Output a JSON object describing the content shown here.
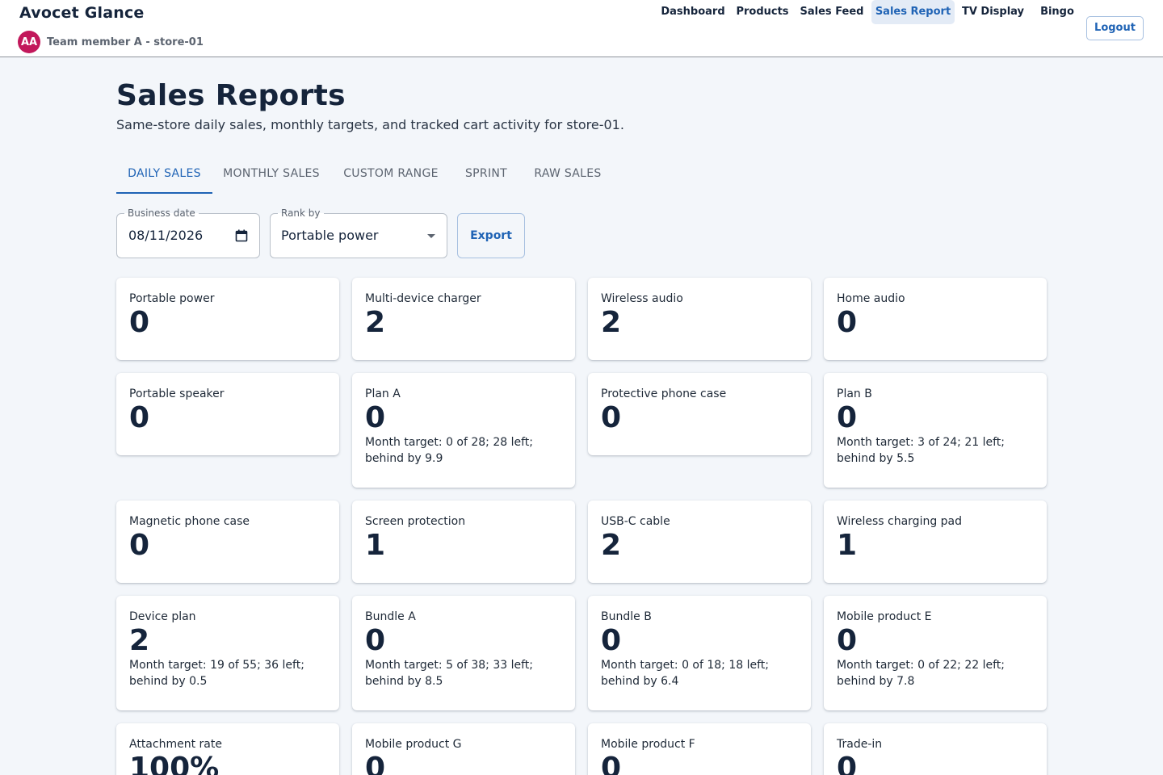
{
  "app": {
    "title": "Avocet Glance",
    "user_initials": "AA",
    "user_label": "Team member A - store-01"
  },
  "nav": {
    "items": [
      {
        "label": "Dashboard",
        "active": false
      },
      {
        "label": "Products",
        "active": false
      },
      {
        "label": "Sales Feed",
        "active": false
      },
      {
        "label": "Sales Report",
        "active": true
      },
      {
        "label": "TV Display",
        "active": false
      },
      {
        "label": "Bingo",
        "active": false
      }
    ],
    "logout_label": "Logout"
  },
  "page": {
    "title": "Sales Reports",
    "subtitle": "Same-store daily sales, monthly targets, and tracked cart activity for store-01."
  },
  "tabs": [
    {
      "label": "DAILY SALES",
      "active": true
    },
    {
      "label": "MONTHLY SALES",
      "active": false
    },
    {
      "label": "CUSTOM RANGE",
      "active": false
    },
    {
      "label": "SPRINT",
      "active": false
    },
    {
      "label": "RAW SALES",
      "active": false
    }
  ],
  "controls": {
    "business_date_label": "Business date",
    "business_date_value": "08/11/2026",
    "rank_by_label": "Rank by",
    "rank_by_value": "Portable power",
    "export_label": "Export"
  },
  "cards": [
    {
      "label": "Portable power",
      "value": "0",
      "note": ""
    },
    {
      "label": "Multi-device charger",
      "value": "2",
      "note": ""
    },
    {
      "label": "Wireless audio",
      "value": "2",
      "note": ""
    },
    {
      "label": "Home audio",
      "value": "0",
      "note": ""
    },
    {
      "label": "Portable speaker",
      "value": "0",
      "note": ""
    },
    {
      "label": "Plan A",
      "value": "0",
      "note": "Month target: 0 of 28; 28 left; behind by 9.9"
    },
    {
      "label": "Protective phone case",
      "value": "0",
      "note": ""
    },
    {
      "label": "Plan B",
      "value": "0",
      "note": "Month target: 3 of 24; 21 left; behind by 5.5"
    },
    {
      "label": "Magnetic phone case",
      "value": "0",
      "note": ""
    },
    {
      "label": "Screen protection",
      "value": "1",
      "note": ""
    },
    {
      "label": "USB-C cable",
      "value": "2",
      "note": ""
    },
    {
      "label": "Wireless charging pad",
      "value": "1",
      "note": ""
    },
    {
      "label": "Device plan",
      "value": "2",
      "note": "Month target: 19 of 55; 36 left; behind by 0.5"
    },
    {
      "label": "Bundle A",
      "value": "0",
      "note": "Month target: 5 of 38; 33 left; behind by 8.5"
    },
    {
      "label": "Bundle B",
      "value": "0",
      "note": "Month target: 0 of 18; 18 left; behind by 6.4"
    },
    {
      "label": "Mobile product E",
      "value": "0",
      "note": "Month target: 0 of 22; 22 left; behind by 7.8"
    },
    {
      "label": "Attachment rate",
      "value": "100%",
      "note": ""
    },
    {
      "label": "Mobile product G",
      "value": "0",
      "note": ""
    },
    {
      "label": "Mobile product F",
      "value": "0",
      "note": ""
    },
    {
      "label": "Trade-in",
      "value": "0",
      "note": ""
    }
  ]
}
